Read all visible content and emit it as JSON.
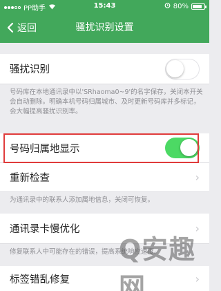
{
  "status_bar": {
    "carrier": "PP助手",
    "time": "15:43",
    "battery_text": "80%",
    "battery_level": 0.8
  },
  "nav": {
    "back_label": "返回",
    "title": "骚扰识别设置"
  },
  "settings": {
    "harassment_id": {
      "label": "骚扰识别",
      "enabled": false,
      "description": "号码库在本地通讯录中以'SRhaoma0~9'的名字保存，关闭本开关会自动删除。明确本机号码归属城市、及时更新号码库并多标记，会大幅提高骚扰识别率。"
    },
    "location_display": {
      "label": "号码归属地显示",
      "enabled": true
    },
    "recheck": {
      "label": "重新检查",
      "description": "为通讯录中的联系人添加属地信息，关闭可恢复。"
    },
    "contacts_lag_optimize": {
      "label": "通讯录卡慢优化",
      "description": "修复联系人中可能存在的错误，提高系统响应速度。"
    },
    "label_garble_repair": {
      "label": "标签错乱修复"
    }
  },
  "watermark": "Q安趣网",
  "colors": {
    "header_green": "#42a85b",
    "toggle_on": "#4cd964",
    "highlight_red": "#e03b3b"
  }
}
